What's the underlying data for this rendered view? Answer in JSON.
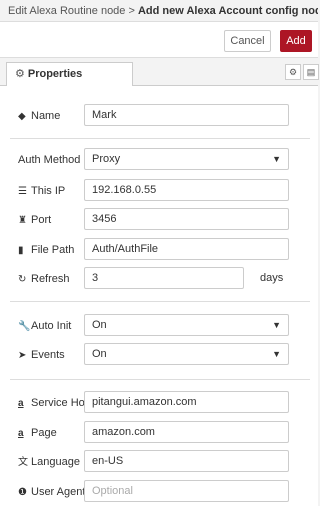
{
  "title": {
    "prefix": "Edit Alexa Routine node > ",
    "current": "Add new Alexa Account config node"
  },
  "actions": {
    "cancel_label": "Cancel",
    "add_label": "Add"
  },
  "tabs": {
    "properties_label": "Properties",
    "properties_icon": "⚙"
  },
  "fields": {
    "name": {
      "label": "Name",
      "value": "Mark"
    },
    "auth_method": {
      "label": "Auth Method",
      "value": "Proxy"
    },
    "this_ip": {
      "label": "This IP",
      "value": "192.168.0.55"
    },
    "port": {
      "label": "Port",
      "value": "3456"
    },
    "file_path": {
      "label": "File Path",
      "value": "Auth/AuthFile"
    },
    "refresh": {
      "label": "Refresh",
      "value": "3",
      "suffix": "days"
    },
    "auto_init": {
      "label": "Auto Init",
      "value": "On"
    },
    "events": {
      "label": "Events",
      "value": "On"
    },
    "service_host": {
      "label": "Service Host",
      "value": "pitangui.amazon.com"
    },
    "page": {
      "label": "Page",
      "value": "amazon.com"
    },
    "language": {
      "label": "Language",
      "value": "en-US"
    },
    "user_agent": {
      "label": "User Agent",
      "placeholder": "Optional"
    }
  },
  "colors": {
    "primary_button": "#ad1625"
  },
  "icons": [
    "tag-icon",
    "list-icon",
    "port-icon",
    "file-icon",
    "refresh-icon",
    "wrench-icon",
    "rocket-icon",
    "amazon-icon",
    "language-icon",
    "info-icon"
  ]
}
